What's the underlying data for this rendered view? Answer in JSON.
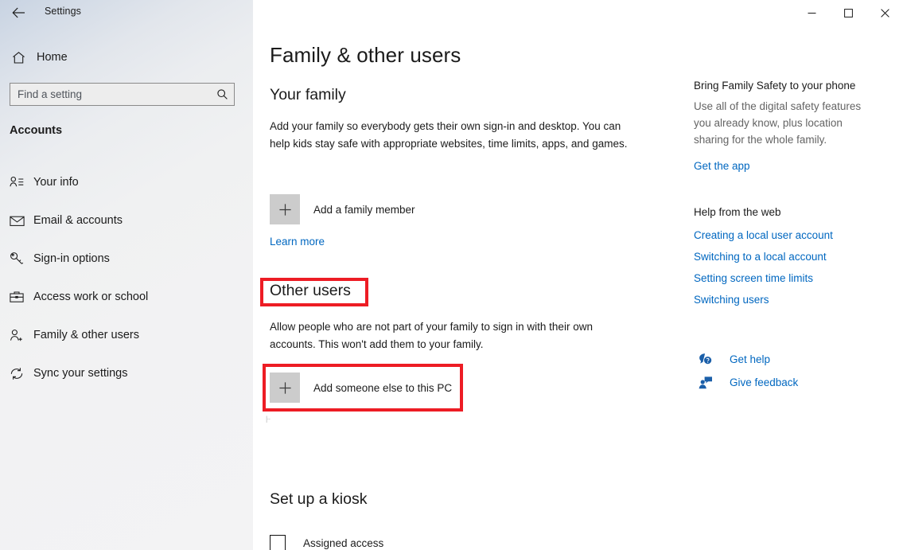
{
  "window": {
    "title": "Settings",
    "back_icon": "back-arrow-icon",
    "minimize_label": "–",
    "maximize_label": "☐",
    "close_label": "✕"
  },
  "sidebar": {
    "home_label": "Home",
    "search": {
      "placeholder": "Find a setting",
      "value": ""
    },
    "section_heading": "Accounts",
    "items": [
      {
        "label": "Your info",
        "icon": "person-list-icon"
      },
      {
        "label": "Email & accounts",
        "icon": "envelope-icon"
      },
      {
        "label": "Sign-in options",
        "icon": "key-icon"
      },
      {
        "label": "Access work or school",
        "icon": "briefcase-icon"
      },
      {
        "label": "Family & other users",
        "icon": "person-plus-icon"
      },
      {
        "label": "Sync your settings",
        "icon": "sync-icon"
      }
    ]
  },
  "main": {
    "page_title": "Family & other users",
    "your_family": {
      "title": "Your family",
      "description": "Add your family so everybody gets their own sign-in and desktop. You can help kids stay safe with appropriate websites, time limits, apps, and games.",
      "add_button_label": "Add a family member",
      "learn_more_label": "Learn more"
    },
    "other_users": {
      "title": "Other users",
      "description": "Allow people who are not part of your family to sign in with their own accounts. This won't add them to your family.",
      "add_button_label": "Add someone else to this PC"
    },
    "kiosk": {
      "title": "Set up a kiosk",
      "assigned_access_label": "Assigned access",
      "assigned_access_checked": false
    },
    "caret_artifact": "|··"
  },
  "rail": {
    "promo": {
      "heading": "Bring Family Safety to your phone",
      "body": "Use all of the digital safety features you already know, plus location sharing for the whole family.",
      "link_label": "Get the app"
    },
    "help": {
      "heading": "Help from the web",
      "links": [
        "Creating a local user account",
        "Switching to a local account",
        "Setting screen time limits",
        "Switching users"
      ]
    },
    "support": [
      {
        "label": "Get help",
        "icon": "help-bubble-icon"
      },
      {
        "label": "Give feedback",
        "icon": "feedback-person-icon"
      }
    ]
  },
  "colors": {
    "accent_link": "#0067c0",
    "highlight_box": "#ed1c24",
    "plus_tile": "#cccccc",
    "sidebar_top": "#c8d3e2",
    "muted_text": "#646464"
  }
}
